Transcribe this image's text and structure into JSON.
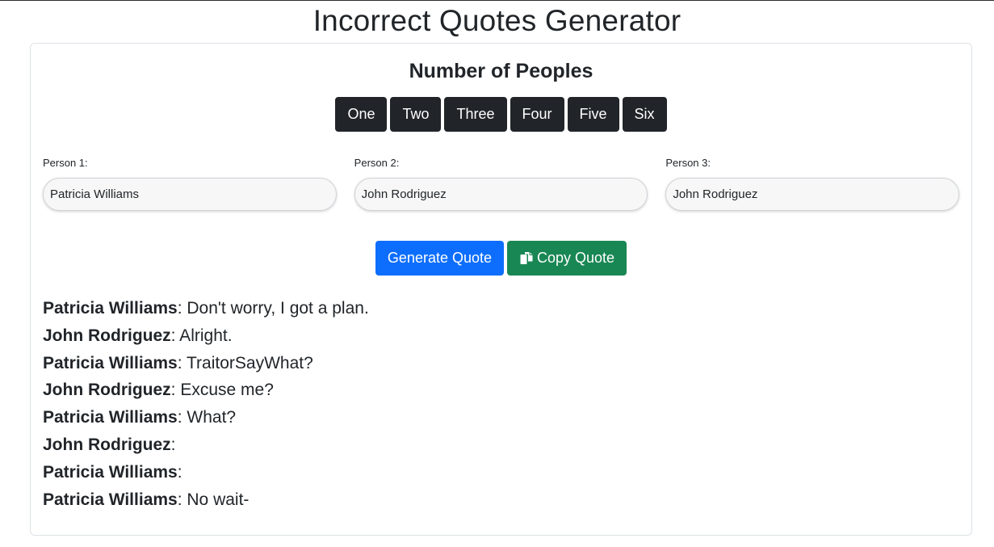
{
  "page_title": "Incorrect Quotes Generator",
  "people_section": {
    "title": "Number of Peoples",
    "buttons": [
      "One",
      "Two",
      "Three",
      "Four",
      "Five",
      "Six"
    ]
  },
  "persons": [
    {
      "label": "Person 1:",
      "value": "Patricia Williams"
    },
    {
      "label": "Person 2:",
      "value": "John Rodriguez"
    },
    {
      "label": "Person 3:",
      "value": "John Rodriguez"
    }
  ],
  "actions": {
    "generate_label": "Generate Quote",
    "copy_label": "Copy Quote",
    "copy_icon": "copy-icon"
  },
  "quote": [
    {
      "speaker": "Patricia Williams",
      "text": ": Don't worry, I got a plan."
    },
    {
      "speaker": "John Rodriguez",
      "text": ": Alright."
    },
    {
      "speaker": "Patricia Williams",
      "text": ": TraitorSayWhat?"
    },
    {
      "speaker": "John Rodriguez",
      "text": ": Excuse me?"
    },
    {
      "speaker": "Patricia Williams",
      "text": ": What?"
    },
    {
      "speaker": "John Rodriguez",
      "text": ":"
    },
    {
      "speaker": "Patricia Williams",
      "text": ":"
    },
    {
      "speaker": "Patricia Williams",
      "text": ": No wait-"
    }
  ],
  "colors": {
    "primary": "#0d6efd",
    "success": "#198754",
    "dark": "#212529"
  }
}
